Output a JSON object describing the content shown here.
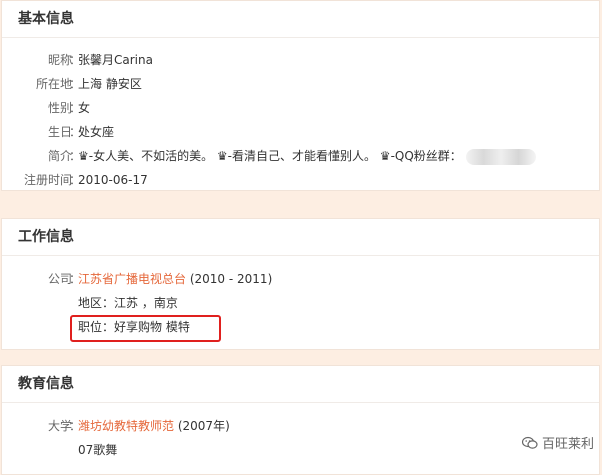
{
  "basic": {
    "title": "基本信息",
    "rows": [
      {
        "label": "昵称",
        "value": "张馨月Carina"
      },
      {
        "label": "所在地",
        "value": "上海 静安区"
      },
      {
        "label": "性别",
        "value": "女"
      },
      {
        "label": "生日",
        "value": "处女座"
      },
      {
        "label": "简介",
        "value": "♛-女人美、不如活的美。 ♛-看清自己、才能看懂别人。 ♛-QQ粉丝群："
      },
      {
        "label": "注册时间",
        "value": "2010-06-17"
      }
    ]
  },
  "work": {
    "title": "工作信息",
    "company_label": "公司",
    "company": "江苏省广播电视总台",
    "company_period": "(2010 - 2011)",
    "region": "地区：江苏 ，南京",
    "position": "职位：好享购物 模特"
  },
  "education": {
    "title": "教育信息",
    "school_label": "大学",
    "school": "潍坊幼教特教师范",
    "school_year": "(2007年)",
    "class": "07歌舞"
  },
  "watermark": {
    "text": "百旺莱利"
  },
  "colors": {
    "link": "#e5683b",
    "highlight_border": "#e0201e",
    "page_bg": "#fdeee2"
  }
}
